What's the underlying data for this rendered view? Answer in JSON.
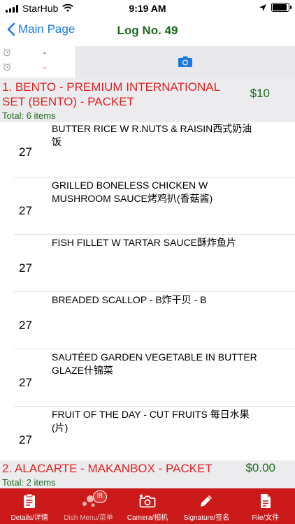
{
  "status_bar": {
    "carrier": "StarHub",
    "time": "9:19 AM",
    "battery_level": 0.9
  },
  "nav": {
    "back_label": "Main Page",
    "title": "Log No. 49"
  },
  "info": {
    "row1_value": "-",
    "row2_value": "-"
  },
  "sections": [
    {
      "name": "1. BENTO - PREMIUM INTERNATIONAL SET (BENTO) - PACKET",
      "price": "$10",
      "total": "Total: 6 items",
      "items": [
        {
          "qty": "",
          "desc": "BUTTER RICE W R.NUTS & RAISIN西式奶油饭"
        },
        {
          "qty": "27",
          "desc": "GRILLED BONELESS CHICKEN W MUSHROOM SAUCE烤鸡扒(香菇酱)"
        },
        {
          "qty": "27",
          "desc": "FISH FILLET W TARTAR SAUCE酥炸鱼片"
        },
        {
          "qty": "27",
          "desc": "BREADED SCALLOP - B炸干贝 - B"
        },
        {
          "qty": "27",
          "desc": "SAUTÉED GARDEN VEGETABLE IN BUTTER GLAZE什锦菜"
        },
        {
          "qty": "27",
          "desc": "FRUIT OF THE DAY - CUT FRUITS  每日水果 (片)"
        }
      ]
    },
    {
      "name": "2. ALACARTE - MAKANBOX - PACKET",
      "price": "$0.00",
      "total": "Total: 2 items"
    }
  ],
  "first_item_qty": "27",
  "tabs": [
    {
      "label": "Details/详情",
      "icon": "clipboard-icon"
    },
    {
      "label": "Dish Menu/菜单",
      "icon": "dots-icon",
      "badge": "!8"
    },
    {
      "label": "Camera/相机",
      "icon": "camera-add-icon"
    },
    {
      "label": "Signature/签名",
      "icon": "pencil-icon"
    },
    {
      "label": "File/文件",
      "icon": "file-icon"
    }
  ],
  "colors": {
    "tab_bar": "#cc1a1a",
    "section_name": "#e02020",
    "price_green": "#1e6a1e",
    "nav_blue": "#1a7be6"
  }
}
